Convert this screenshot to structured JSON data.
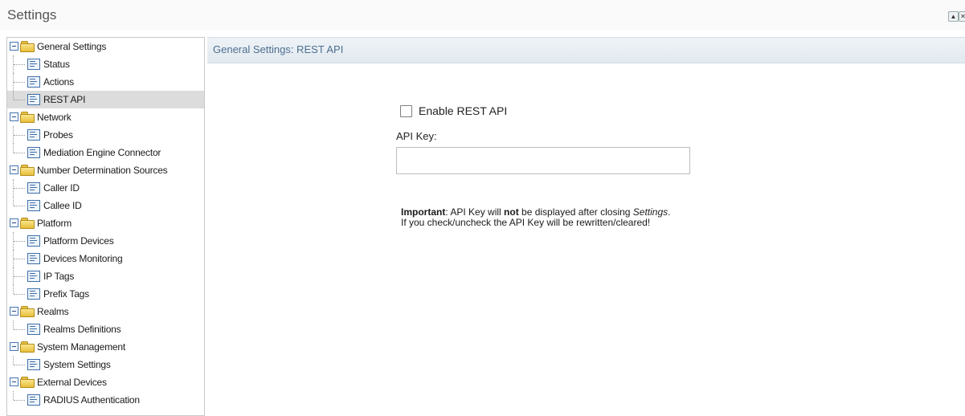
{
  "window": {
    "title": "Settings",
    "button_up": "▲",
    "button_close": "✕"
  },
  "tree": {
    "categories": [
      {
        "label": "General Settings",
        "items": [
          {
            "label": "Status"
          },
          {
            "label": "Actions"
          },
          {
            "label": "REST API",
            "selected": true
          }
        ]
      },
      {
        "label": "Network",
        "items": [
          {
            "label": "Probes"
          },
          {
            "label": "Mediation Engine Connector"
          }
        ]
      },
      {
        "label": "Number Determination Sources",
        "items": [
          {
            "label": "Caller ID"
          },
          {
            "label": "Callee ID"
          }
        ]
      },
      {
        "label": "Platform",
        "items": [
          {
            "label": "Platform Devices"
          },
          {
            "label": "Devices Monitoring"
          },
          {
            "label": "IP Tags"
          },
          {
            "label": "Prefix Tags"
          }
        ]
      },
      {
        "label": "Realms",
        "items": [
          {
            "label": "Realms Definitions"
          }
        ]
      },
      {
        "label": "System Management",
        "items": [
          {
            "label": "System Settings"
          }
        ]
      },
      {
        "label": "External Devices",
        "items": [
          {
            "label": "RADIUS Authentication"
          }
        ]
      }
    ]
  },
  "panel": {
    "header": "General Settings: REST API",
    "enable_label": "Enable REST API",
    "enable_checked": false,
    "api_key_label": "API Key:",
    "api_key_value": "",
    "note": {
      "line1_bold": "Important",
      "line1_a": ": API Key will ",
      "line1_bold2": "not",
      "line1_b": " be displayed after closing ",
      "line1_italic": "Settings",
      "line1_c": ".",
      "line2": "If you check/uncheck the API Key will be rewritten/cleared!"
    }
  }
}
